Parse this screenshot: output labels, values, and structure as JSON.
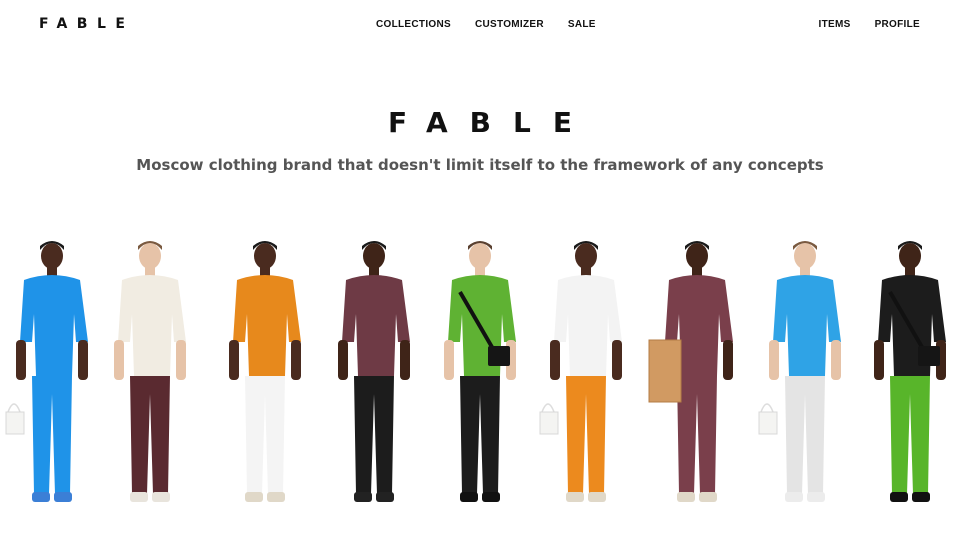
{
  "nav": {
    "logo": "FABLE",
    "center_links": [
      "COLLECTIONS",
      "CUSTOMIZER",
      "SALE"
    ],
    "right_links": [
      "ITEMS",
      "PROFILE"
    ]
  },
  "hero": {
    "title": "FABLE",
    "subtitle": "Moscow clothing brand that doesn't limit itself to the framework of any concepts"
  },
  "models": [
    {
      "top": "#1f93e8",
      "bottom": "#1f93e8",
      "skin": "#4a2b1f",
      "hair": "#1a1a1a",
      "shoes": "#3b7fd6",
      "accessory": "tote"
    },
    {
      "top": "#f1ece2",
      "bottom": "#5a2a30",
      "skin": "#e6c3a8",
      "hair": "#7a5a40",
      "shoes": "#e8e4dc",
      "accessory": "none"
    },
    {
      "top": "#e7891c",
      "bottom": "#f4f4f4",
      "skin": "#4a2b1f",
      "hair": "#1a1a1a",
      "shoes": "#e0d8c8",
      "accessory": "none"
    },
    {
      "top": "#6e3a45",
      "bottom": "#1c1c1c",
      "skin": "#3f2418",
      "hair": "#1a1a1a",
      "shoes": "#222222",
      "accessory": "none"
    },
    {
      "top": "#5fb233",
      "bottom": "#1c1c1c",
      "skin": "#e6c3a8",
      "hair": "#5a4030",
      "shoes": "#111111",
      "accessory": "bag"
    },
    {
      "top": "#f3f3f3",
      "bottom": "#ec8a1e",
      "skin": "#4a2b1f",
      "hair": "#1a1a1a",
      "shoes": "#e0d8c8",
      "accessory": "tote"
    },
    {
      "top": "#7a3f4b",
      "bottom": "#7a3f4b",
      "skin": "#3f2418",
      "hair": "#1a1a1a",
      "shoes": "#e0d8c8",
      "accessory": "box"
    },
    {
      "top": "#2fa3e6",
      "bottom": "#e4e4e4",
      "skin": "#e6c3a8",
      "hair": "#7a5a40",
      "shoes": "#ececec",
      "accessory": "tote"
    },
    {
      "top": "#1c1c1c",
      "bottom": "#58b52a",
      "skin": "#3f2418",
      "hair": "#1a1a1a",
      "shoes": "#111111",
      "accessory": "bag"
    }
  ]
}
